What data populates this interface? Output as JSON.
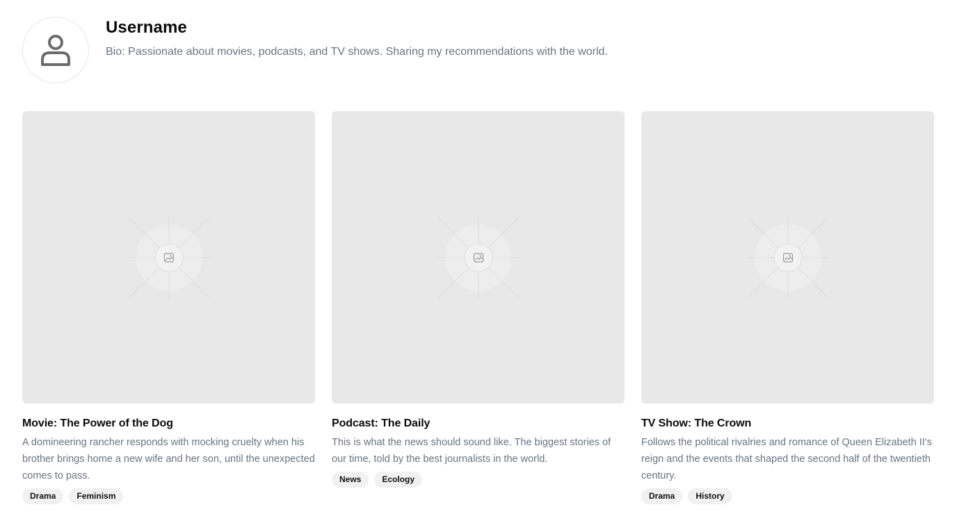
{
  "profile": {
    "username": "Username",
    "bio": "Bio: Passionate about movies, podcasts, and TV shows. Sharing my recommendations with the world.",
    "avatar_icon": "user-icon"
  },
  "cards": [
    {
      "title": "Movie: The Power of the Dog",
      "description": "A domineering rancher responds with mocking cruelty when his brother brings home a new wife and her son, until the unexpected comes to pass.",
      "tags": [
        "Drama",
        "Feminism"
      ],
      "image_icon": "image-placeholder-icon"
    },
    {
      "title": "Podcast: The Daily",
      "description": "This is what the news should sound like. The biggest stories of our time, told by the best journalists in the world.",
      "tags": [
        "News",
        "Ecology"
      ],
      "image_icon": "image-placeholder-icon"
    },
    {
      "title": "TV Show: The Crown",
      "description": "Follows the political rivalries and romance of Queen Elizabeth II's reign and the events that shaped the second half of the twentieth century.",
      "tags": [
        "Drama",
        "History"
      ],
      "image_icon": "image-placeholder-icon"
    }
  ],
  "colors": {
    "text": "#0a0a0a",
    "muted": "#6b7280",
    "placeholder_bg": "#e8e8e8",
    "tag_bg": "#f1f1f2"
  }
}
